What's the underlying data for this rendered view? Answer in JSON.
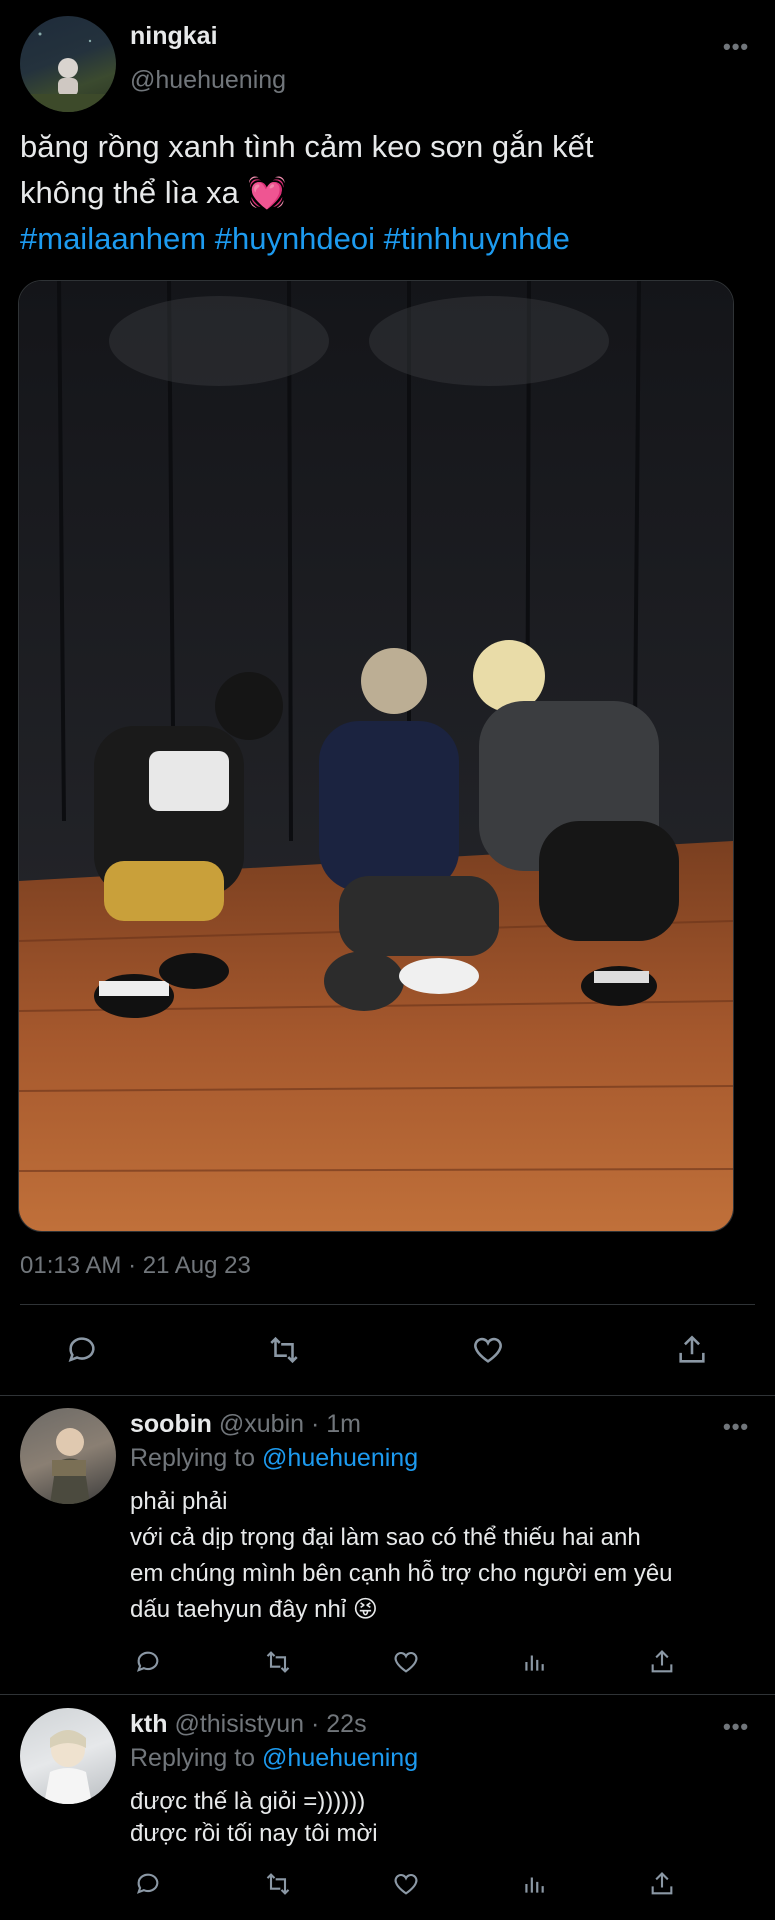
{
  "main_tweet": {
    "display_name": "ningkai",
    "handle": "@huehuening",
    "text_line1": "băng rồng xanh tình cảm keo sơn gắn kết",
    "text_line2": "không thể lìa xa",
    "emoji": "💓",
    "hashtags": "#mailaanhem #huynhdeoi #tinhhuynhde",
    "timestamp": "01:13 AM · 21 Aug 23",
    "more_label": "•••",
    "actions": [
      "reply-icon",
      "retweet-icon",
      "like-icon",
      "share-icon"
    ]
  },
  "replies": [
    {
      "display_name": "soobin",
      "handle": "@xubin",
      "time": "· 1m",
      "replying_prefix": "Replying to",
      "replying_to": "@huehuening",
      "lines": [
        "phải phải",
        "với cả dịp trọng đại làm sao có thể thiếu hai anh",
        "em chúng mình bên cạnh hỗ trợ cho người em yêu",
        "dấu taehyun đây nhỉ 😝"
      ],
      "more_label": "•••"
    },
    {
      "display_name": "kth",
      "handle": "@thisistyun",
      "time": "· 22s",
      "replying_prefix": "Replying to",
      "replying_to": "@huehuening",
      "lines": [
        "được thế là giỏi =))))))",
        "được rồi tối nay tôi mời"
      ],
      "more_label": "•••"
    }
  ],
  "colors": {
    "background": "#000000",
    "text": "#e7e9ea",
    "muted": "#71767b",
    "link": "#1d9bf0",
    "divider": "#2f3336"
  }
}
